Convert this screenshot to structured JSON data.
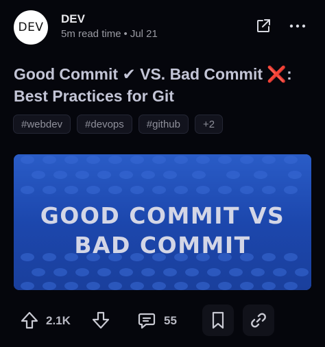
{
  "source": {
    "avatar_text": "DEV",
    "name": "DEV",
    "read_time": "5m read time",
    "separator": "•",
    "date": "Jul 21"
  },
  "post": {
    "title_part1": "Good Commit",
    "title_check": "✔",
    "title_part2": " VS. Bad Commit",
    "title_cross": "❌",
    "title_part3": ": Best Practices for Git",
    "tags": [
      "#webdev",
      "#devops",
      "#github",
      "+2"
    ],
    "cover_line1": "GOOD COMMIT VS",
    "cover_line2": "BAD COMMIT"
  },
  "actions": {
    "upvotes": "2.1K",
    "comments": "55"
  },
  "icons": {
    "open_link": "open-external-icon",
    "more": "more-horizontal-icon",
    "upvote": "arrow-up-icon",
    "downvote": "arrow-down-icon",
    "comment": "comment-icon",
    "bookmark": "bookmark-icon",
    "copy_link": "link-icon"
  },
  "colors": {
    "background": "#05060c",
    "title": "#c3c5d6",
    "cross": "#e0383e",
    "cover_blue": "#1f4db4"
  }
}
